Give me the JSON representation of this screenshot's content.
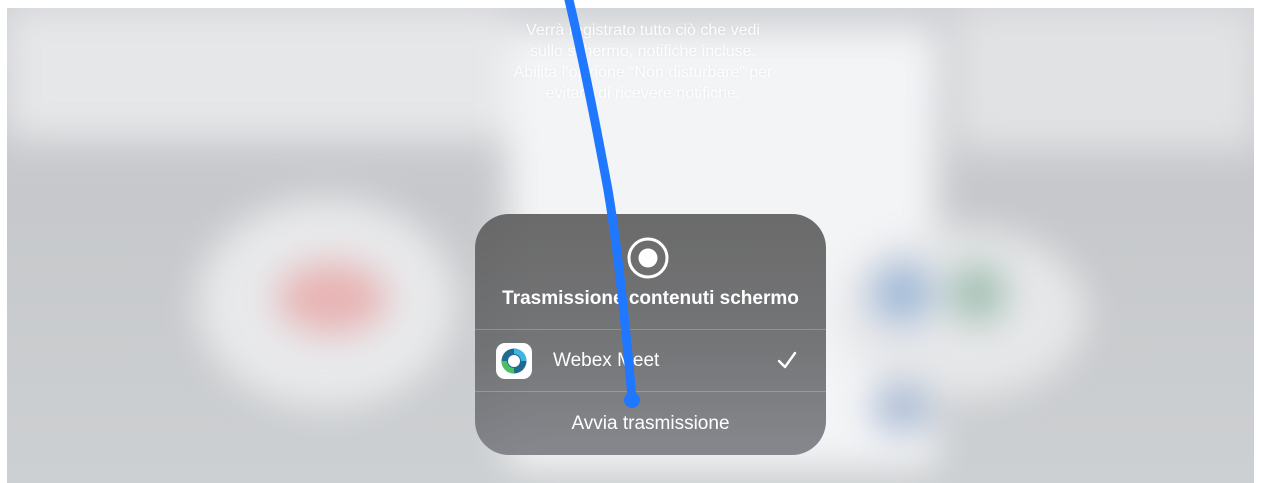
{
  "recording_warning": {
    "line1": "Verrà registrato tutto ciò che vedi",
    "line2": "sullo schermo, notifiche incluse.",
    "line3": "Abilita l’opzione “Non disturbare” per",
    "line4": "evitare di ricevere notifiche."
  },
  "broadcast_panel": {
    "icon": "record-icon",
    "title": "Trasmissione contenuti schermo",
    "app": {
      "name": "Webex Meet",
      "icon": "webex-meet-app-icon",
      "selected": true,
      "check_icon": "checkmark-icon"
    },
    "start_button_label": "Avvia trasmissione"
  },
  "colors": {
    "panel_background": "#666668",
    "text": "#ffffff",
    "annotation_stroke": "#1f78ff"
  }
}
